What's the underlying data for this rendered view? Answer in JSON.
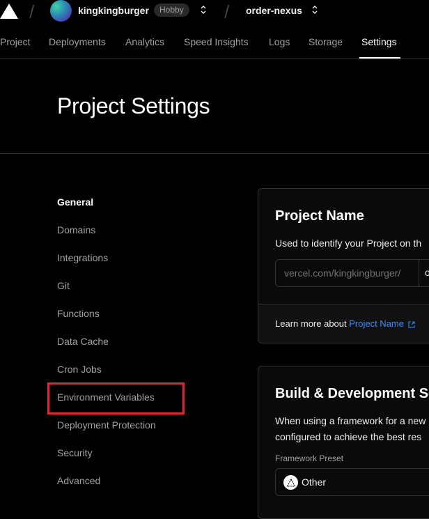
{
  "topbar": {
    "username": "kingkingburger",
    "plan_badge": "Hobby",
    "project": "order-nexus"
  },
  "tabs": [
    "Project",
    "Deployments",
    "Analytics",
    "Speed Insights",
    "Logs",
    "Storage",
    "Settings"
  ],
  "active_tab": "Settings",
  "page": {
    "title": "Project Settings"
  },
  "sidebar": {
    "items": [
      {
        "label": "General"
      },
      {
        "label": "Domains"
      },
      {
        "label": "Integrations"
      },
      {
        "label": "Git"
      },
      {
        "label": "Functions"
      },
      {
        "label": "Data Cache"
      },
      {
        "label": "Cron Jobs"
      },
      {
        "label": "Environment Variables"
      },
      {
        "label": "Deployment Protection"
      },
      {
        "label": "Security"
      },
      {
        "label": "Advanced"
      }
    ],
    "active": "General",
    "highlighted": "Environment Variables"
  },
  "project_name_card": {
    "title": "Project Name",
    "description": "Used to identify your Project on th",
    "url_prefix": "vercel.com/kingkingburger/",
    "url_value": "o",
    "footer_text": "Learn more about ",
    "footer_link": "Project Name"
  },
  "build_card": {
    "title": "Build & Development Se",
    "description_line1": "When using a framework for a new",
    "description_line2": "configured to achieve the best res",
    "framework_label": "Framework Preset",
    "framework_value": "Other"
  },
  "colors": {
    "background": "#000000",
    "accent_link": "#3b8cff",
    "highlight_box": "#e0262e"
  }
}
